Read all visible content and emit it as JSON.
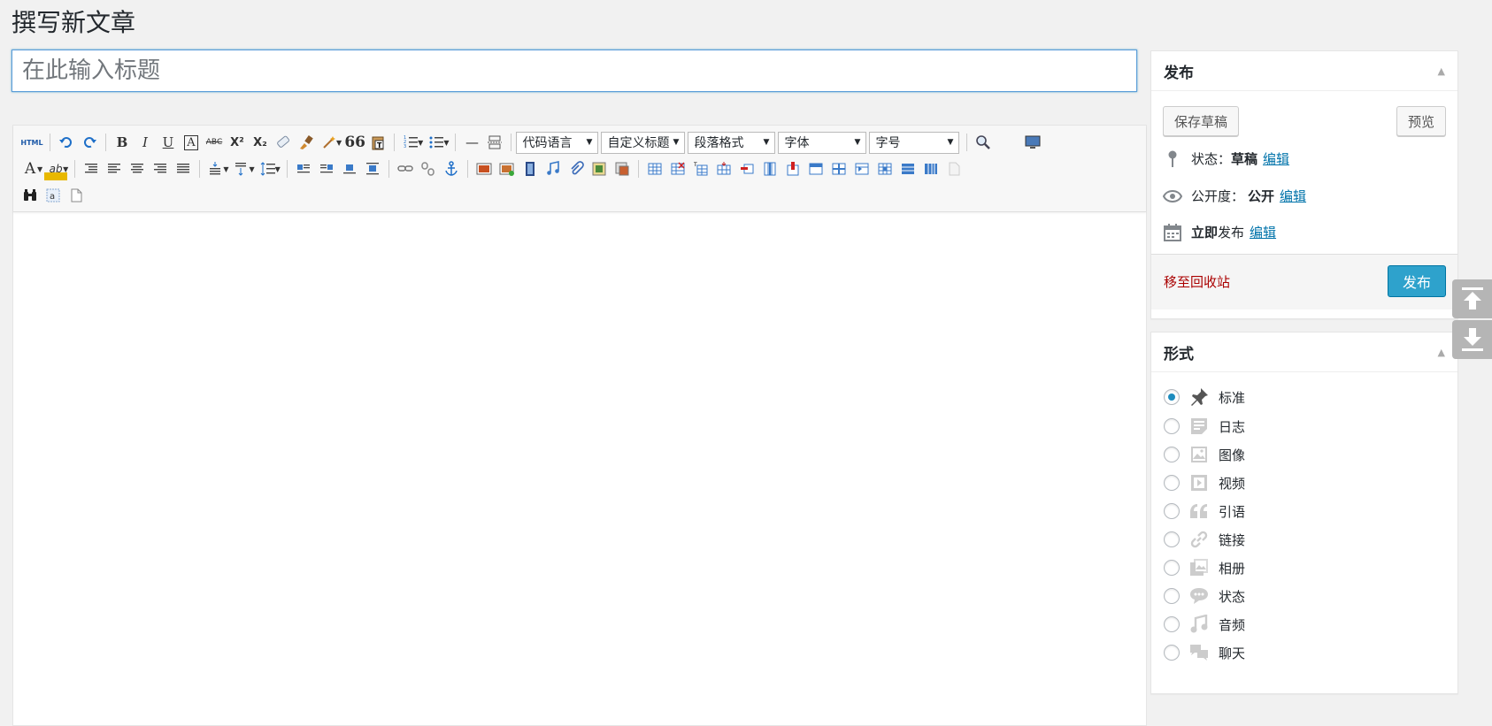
{
  "page": {
    "title": "撰写新文章"
  },
  "title_field": {
    "placeholder": "在此输入标题",
    "value": ""
  },
  "toolbar": {
    "html_label": "HTML",
    "selects": {
      "code_lang": "代码语言",
      "custom_heading": "自定义标题",
      "paragraph": "段落格式",
      "font": "字体",
      "font_size": "字号"
    },
    "glyphs": {
      "bold": "B",
      "italic": "I",
      "underline": "U",
      "forecolor": "A",
      "strike": "ABC",
      "quote": "66",
      "hr": "—",
      "sup": "X²",
      "sub": "X₂",
      "highlight": "ab"
    }
  },
  "publish_box": {
    "title": "发布",
    "save_draft": "保存草稿",
    "preview": "预览",
    "status_label": "状态：",
    "status_value": "草稿",
    "visibility_label": "公开度：",
    "visibility_value": "公开",
    "schedule_bold": "立即",
    "schedule_rest": "发布",
    "edit_link": "编辑",
    "trash": "移至回收站",
    "publish": "发布"
  },
  "format_box": {
    "title": "形式",
    "options": [
      {
        "label": "标准",
        "icon": "pushpin-icon",
        "checked": true
      },
      {
        "label": "日志",
        "icon": "aside-icon",
        "checked": false
      },
      {
        "label": "图像",
        "icon": "image-icon",
        "checked": false
      },
      {
        "label": "视频",
        "icon": "video-icon",
        "checked": false
      },
      {
        "label": "引语",
        "icon": "quote-icon",
        "checked": false
      },
      {
        "label": "链接",
        "icon": "link-icon",
        "checked": false
      },
      {
        "label": "相册",
        "icon": "gallery-icon",
        "checked": false
      },
      {
        "label": "状态",
        "icon": "status-icon",
        "checked": false
      },
      {
        "label": "音频",
        "icon": "audio-icon",
        "checked": false
      },
      {
        "label": "聊天",
        "icon": "chat-icon",
        "checked": false
      }
    ]
  },
  "colors": {
    "accent": "#2ea2cc",
    "link": "#0073aa",
    "trash": "#aa0000",
    "background": "#f1f1f1"
  }
}
